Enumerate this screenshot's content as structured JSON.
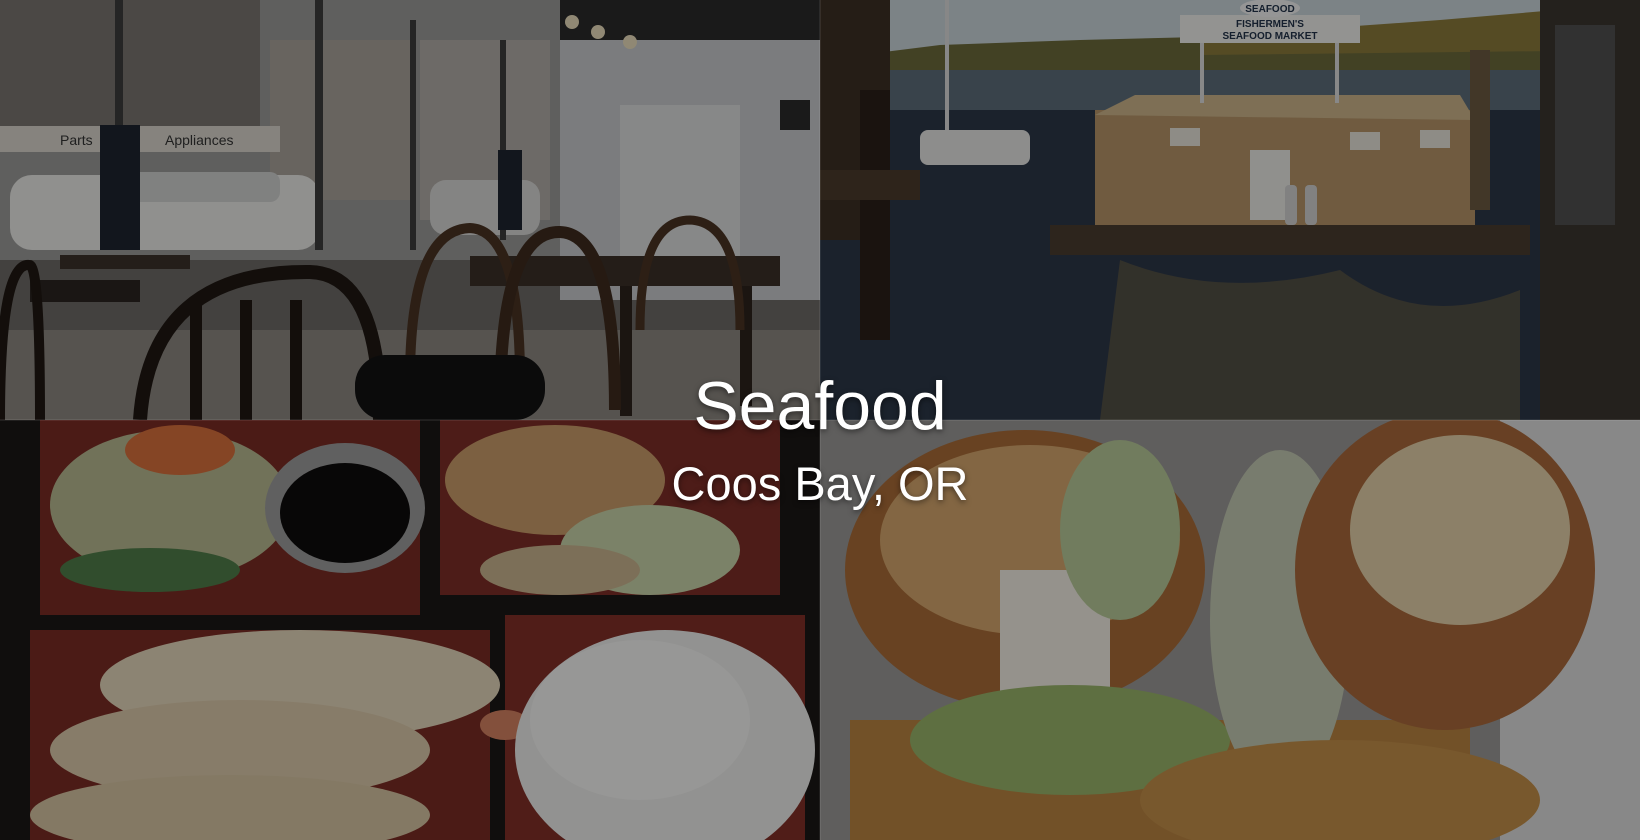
{
  "hero": {
    "title": "Seafood",
    "subtitle": "Coos Bay, OR"
  },
  "photos": [
    {
      "name": "restaurant-interior-photo",
      "signs": [
        "Parts",
        "Appliances"
      ]
    },
    {
      "name": "harbor-market-photo",
      "signs": [
        "SEAFOOD",
        "FISHERMEN'S",
        "SEAFOOD MARKET"
      ]
    },
    {
      "name": "tempura-bento-photo",
      "signs": []
    },
    {
      "name": "fish-sandwich-photo",
      "signs": []
    }
  ],
  "colors": {
    "overlay": "#000000",
    "text": "#ffffff"
  }
}
